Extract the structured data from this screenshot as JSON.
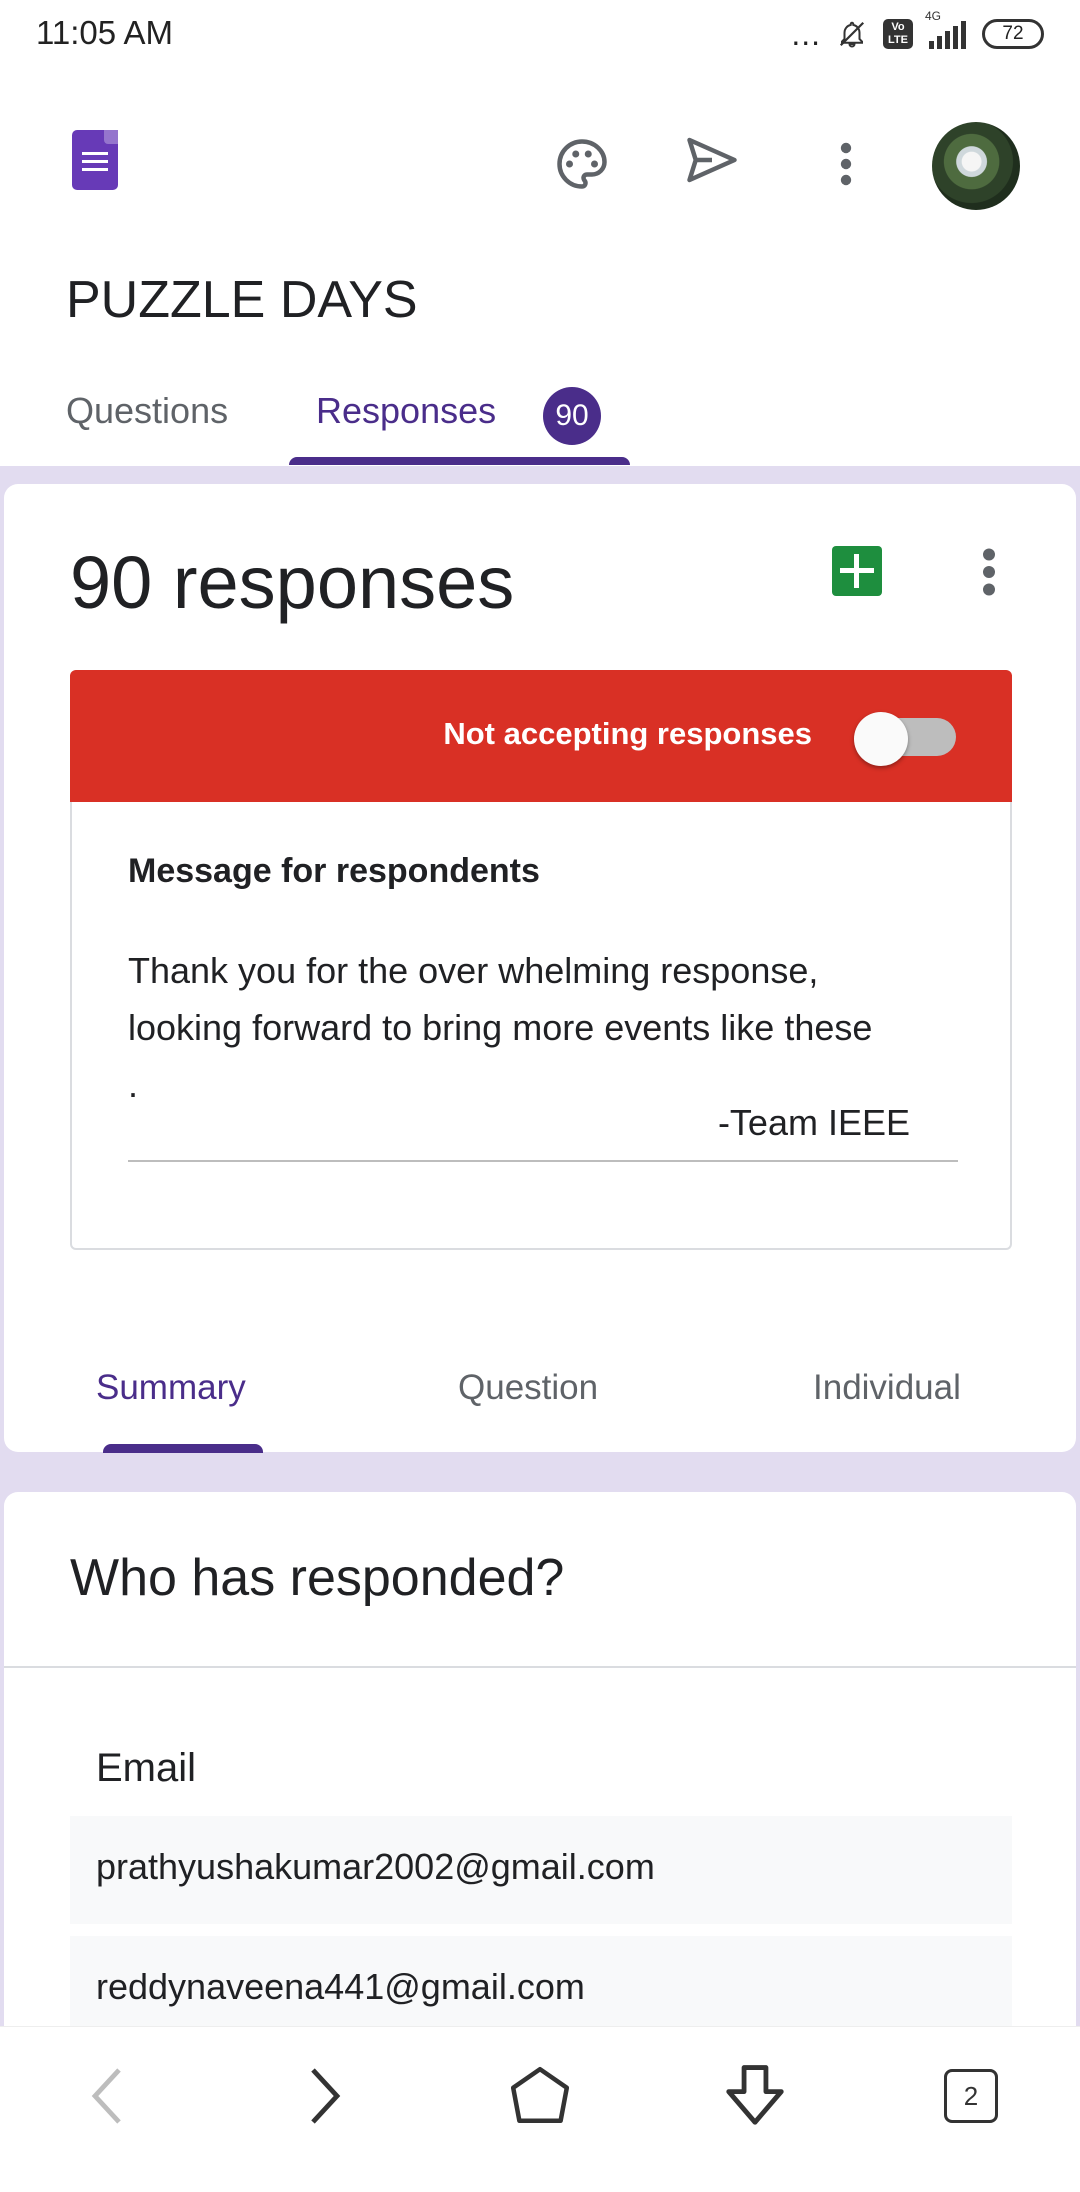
{
  "status_bar": {
    "time": "11:05 AM",
    "dots": "...",
    "volte": "Vo LTE",
    "network": "4G",
    "battery": "72"
  },
  "app_bar": {
    "icons": [
      "forms-logo-icon",
      "palette-icon",
      "send-icon",
      "more-vert-icon",
      "avatar"
    ]
  },
  "form": {
    "title": "PUZZLE DAYS"
  },
  "tabs": {
    "questions": "Questions",
    "responses": "Responses",
    "responses_badge": "90"
  },
  "responses_card": {
    "count_title": "90 responses",
    "banner_text": "Not accepting responses",
    "accepting": false,
    "message_label": "Message for respondents",
    "message_body": "Thank you for the over whelming response,\nlooking forward to bring more events like these\n.",
    "message_sign": "-Team IEEE"
  },
  "subtabs": {
    "summary": "Summary",
    "question": "Question",
    "individual": "Individual"
  },
  "who_card": {
    "title": "Who has responded?",
    "column_header": "Email",
    "emails": [
      "prathyushakumar2002@gmail.com",
      "reddynaveena441@gmail.com"
    ]
  },
  "bottom_nav": {
    "tab_count": "2"
  },
  "colors": {
    "accent": "#4a2d8a",
    "banner_red": "#d93025",
    "sheets_green": "#1e8e3e",
    "lavender_bg": "#e2dcf0"
  }
}
